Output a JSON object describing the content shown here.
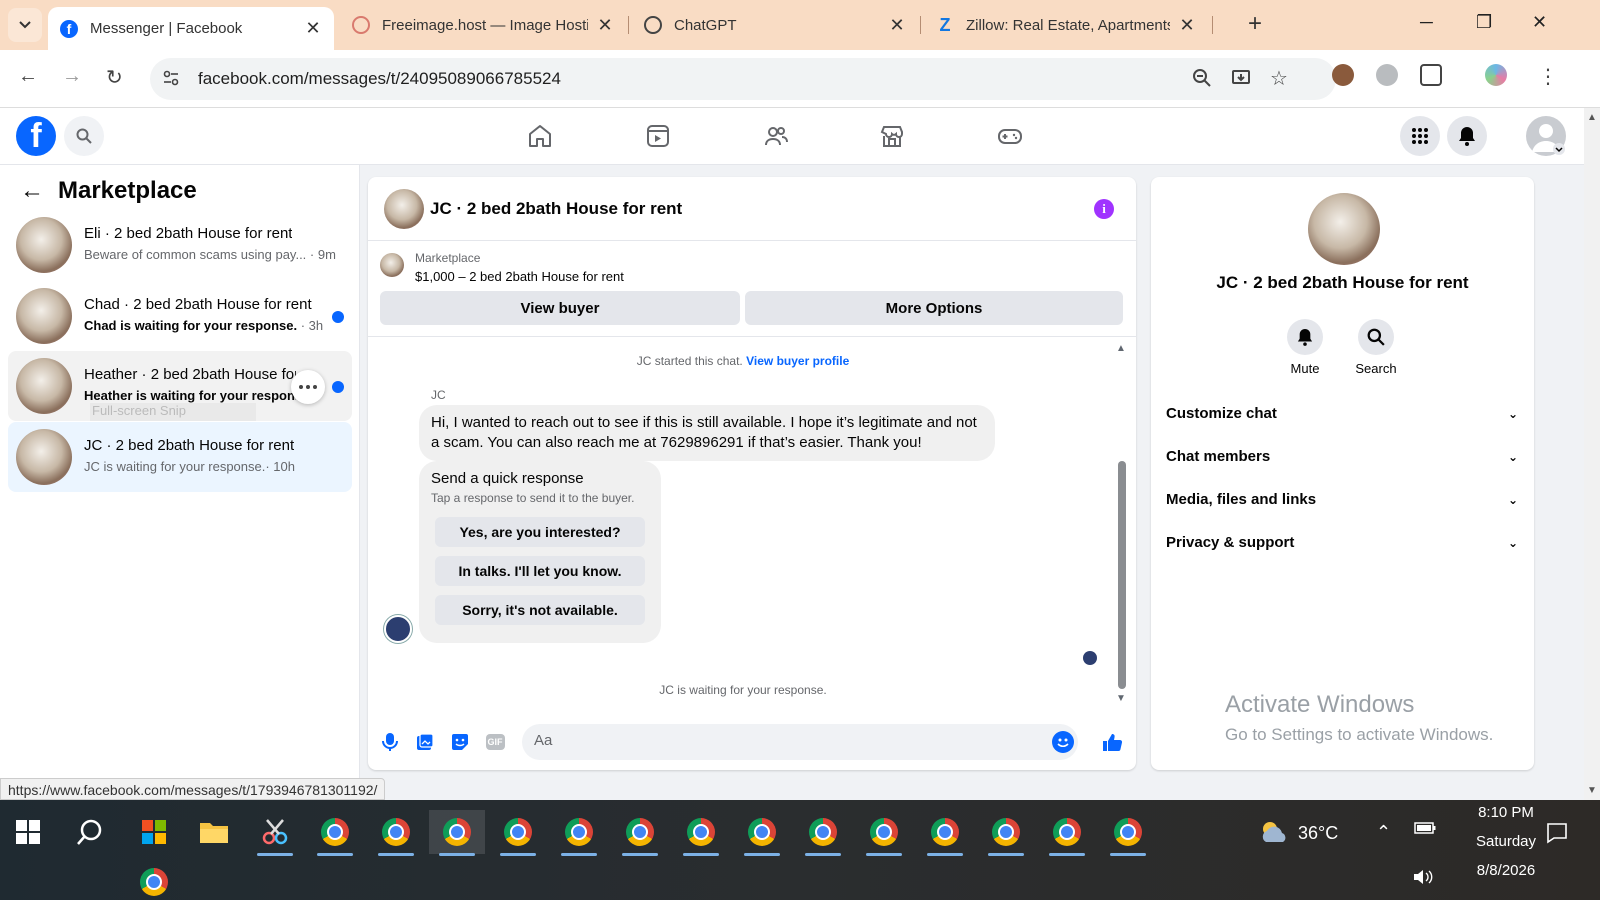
{
  "browser": {
    "tabs": [
      {
        "title": "Messenger | Facebook",
        "icon": "facebook-icon",
        "active": true
      },
      {
        "title": "Freeimage.host — Image Hostin",
        "icon": "freeimage-icon",
        "active": false
      },
      {
        "title": "ChatGPT",
        "icon": "chatgpt-icon",
        "active": false
      },
      {
        "title": "Zillow: Real Estate, Apartments,",
        "icon": "zillow-icon",
        "active": false
      }
    ],
    "url": "facebook.com/messages/t/24095089066785524",
    "status_url": "https://www.facebook.com/messages/t/1793946781301192/"
  },
  "left": {
    "title": "Marketplace",
    "chats": [
      {
        "name": "Eli · 2 bed 2bath House for rent",
        "preview": "Beware of common scams using pay...",
        "time": "· 9m",
        "unread": false
      },
      {
        "name": "Chad · 2 bed 2bath House for rent",
        "preview": "Chad is waiting for your response.",
        "time": "· 3h",
        "unread": true
      },
      {
        "name": "Heather · 2 bed 2bath House for rent",
        "preview": "Heather is waiting for your respon...",
        "time": "",
        "unread": true
      },
      {
        "name": "JC · 2 bed 2bath House for rent",
        "preview": "JC is waiting for your response.",
        "time": "· 10h",
        "unread": false
      }
    ],
    "snip_text": "Full-screen Snip"
  },
  "conversation": {
    "title": "JC · 2 bed 2bath House for rent",
    "listing_source": "Marketplace",
    "listing_price": "$1,000 – 2 bed 2bath House for rent",
    "view_buyer": "View buyer",
    "more_options": "More Options",
    "started_text": "JC started this chat.",
    "buyer_profile_link": "View buyer profile",
    "sender": "JC",
    "message": "Hi, I wanted to reach out to see if this is still available. I hope it’s legitimate and not a scam. You can also reach me at 7629896291 if that’s easier. Thank you!",
    "quick_title": "Send a quick response",
    "quick_sub": "Tap a response to send it to the buyer.",
    "quick_options": [
      "Yes, are you interested?",
      "In talks. I'll let you know.",
      "Sorry, it's not available."
    ],
    "waiting": "JC is waiting for your response.",
    "composer_placeholder": "Aa",
    "gif_label": "GIF"
  },
  "right": {
    "name": "JC · 2 bed 2bath House for rent",
    "mute": "Mute",
    "search": "Search",
    "sections": [
      "Customize chat",
      "Chat members",
      "Media, files and links",
      "Privacy & support"
    ],
    "activate_title": "Activate Windows",
    "activate_sub": "Go to Settings to activate Windows."
  },
  "taskbar": {
    "temperature": "36°C",
    "time": "8:10 PM",
    "day": "Saturday",
    "date": "8/8/2026"
  },
  "colors": {
    "facebook_blue": "#0866ff",
    "accent_purple": "#a033ff",
    "tab_strip": "#f9dcc4"
  }
}
